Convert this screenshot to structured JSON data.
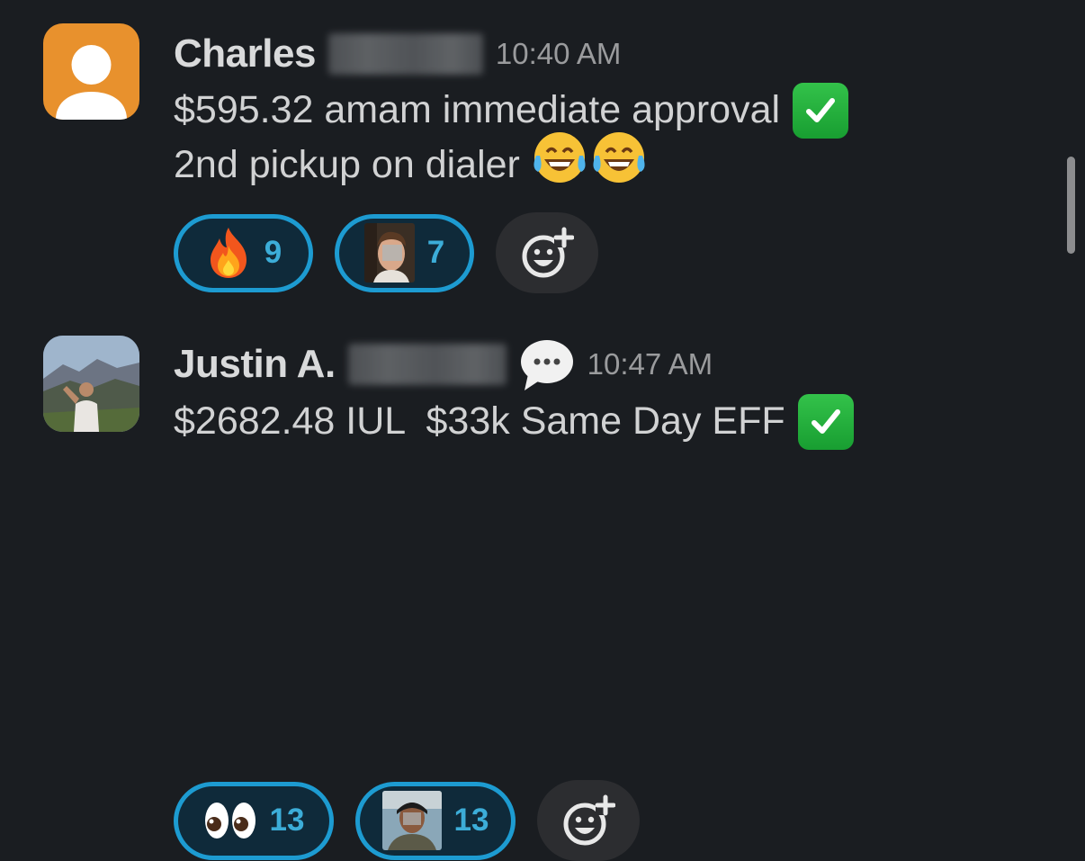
{
  "messages": [
    {
      "author": "Charles",
      "time": "10:40 AM",
      "lines": [
        "$595.32 amam immediate approval",
        "2nd pickup on dialer"
      ],
      "reactions": [
        {
          "emoji": "fire",
          "count": "9"
        },
        {
          "emoji": "custom-face",
          "count": "7"
        }
      ]
    },
    {
      "author": "Justin A.",
      "time": "10:47 AM",
      "lines": [
        "$2682.48 IUL  $33k Same Day EFF"
      ],
      "reactions": [
        {
          "emoji": "eyes",
          "count": "13"
        },
        {
          "emoji": "custom-face",
          "count": "13"
        }
      ]
    }
  ],
  "colors": {
    "background": "#1a1d21",
    "reaction_border": "#1d9bd1",
    "reaction_count": "#3cadd8",
    "avatar_orange": "#e8912d",
    "check_green": "#2bb540"
  },
  "icons": {
    "status": "speech-bubble-icon",
    "add_reaction": "add-emoji-icon",
    "inline_1": "check-mark-button-emoji",
    "inline_2": "tears-of-joy-emoji"
  }
}
